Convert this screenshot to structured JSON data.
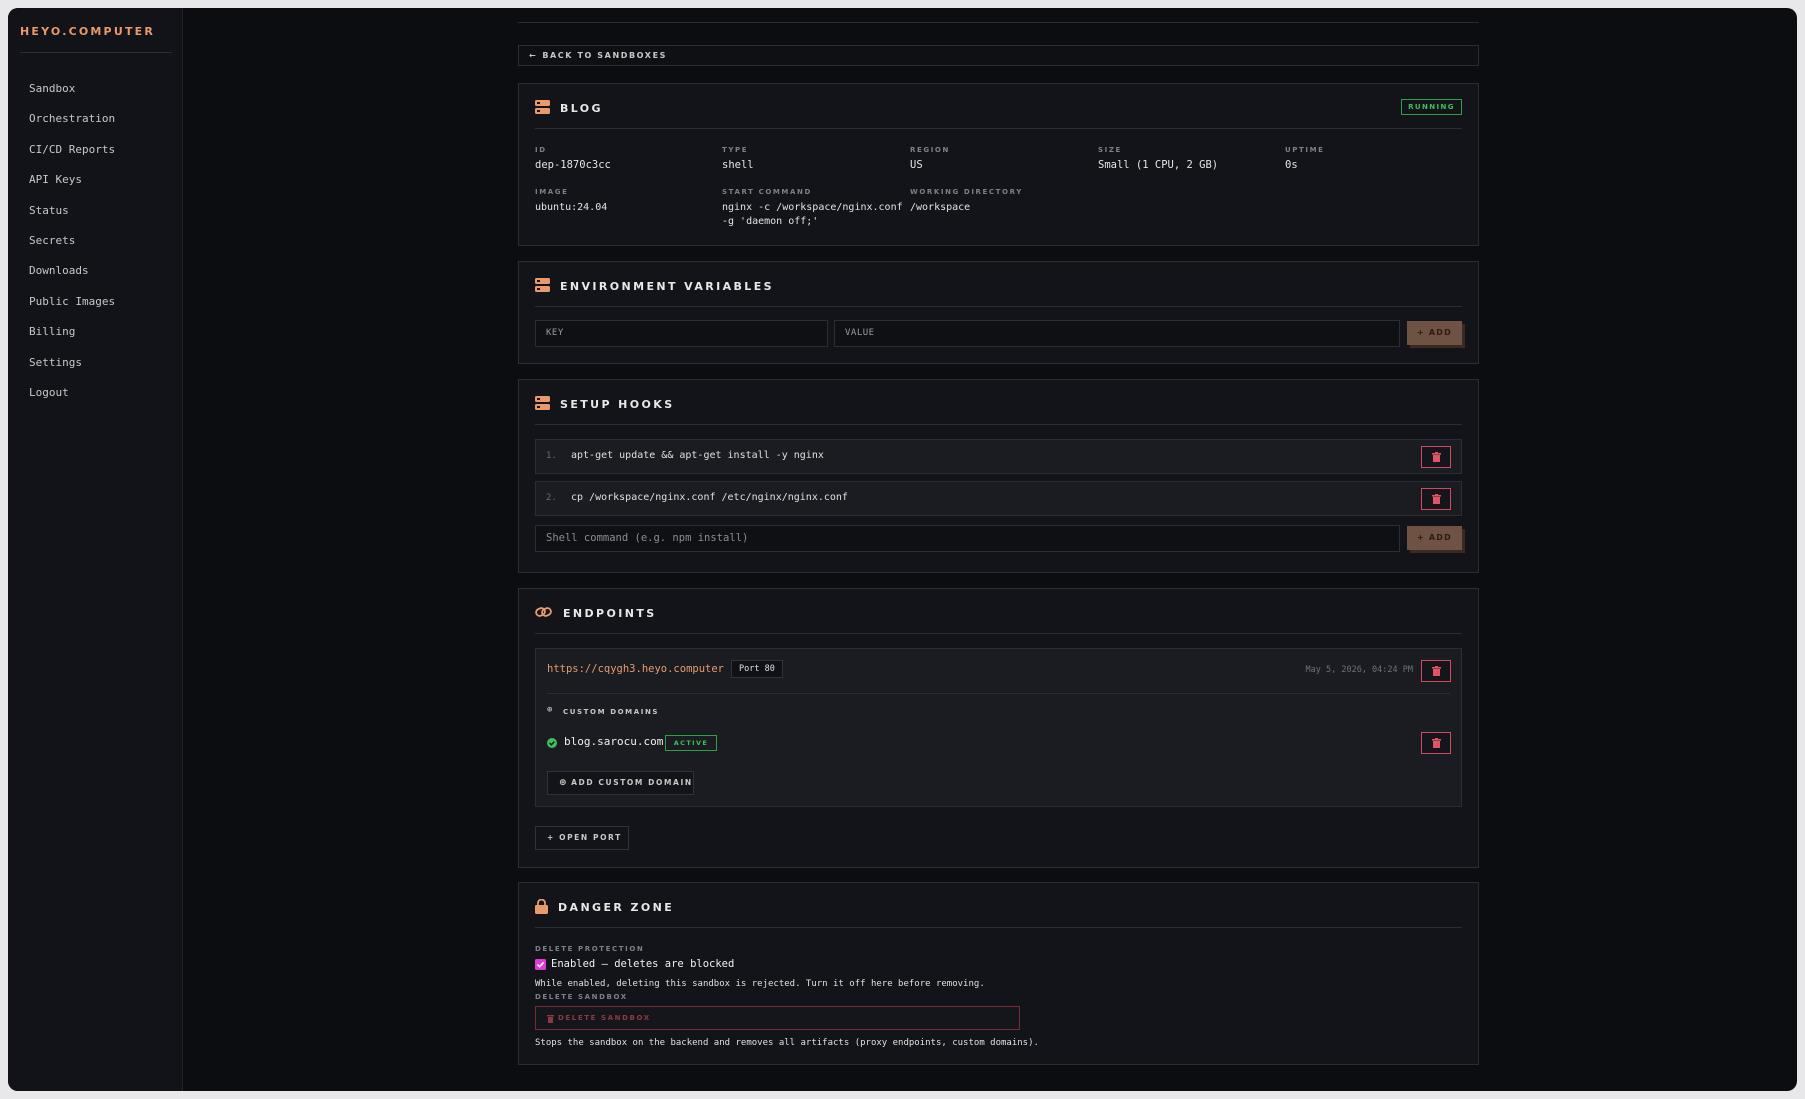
{
  "brand": "HEYO.COMPUTER",
  "nav": [
    "Sandbox",
    "Orchestration",
    "CI/CD Reports",
    "API Keys",
    "Status",
    "Secrets",
    "Downloads",
    "Public Images",
    "Billing",
    "Settings",
    "Logout"
  ],
  "back_label": "BACK TO SANDBOXES",
  "sandbox": {
    "title": "BLOG",
    "status": "RUNNING",
    "fields": {
      "id_label": "ID",
      "id": "dep-1870c3cc",
      "type_label": "TYPE",
      "type": "shell",
      "region_label": "REGION",
      "region": "US",
      "size_label": "SIZE",
      "size": "Small (1 CPU, 2 GB)",
      "uptime_label": "UPTIME",
      "uptime": "0s",
      "image_label": "IMAGE",
      "image": "ubuntu:24.04",
      "start_label": "START COMMAND",
      "start_line1": "nginx -c /workspace/nginx.conf",
      "start_line2": "-g 'daemon off;'",
      "workdir_label": "WORKING DIRECTORY",
      "workdir": "/workspace"
    }
  },
  "env": {
    "title": "ENVIRONMENT VARIABLES",
    "key_placeholder": "KEY",
    "value_placeholder": "VALUE",
    "add_label": "+ ADD"
  },
  "hooks": {
    "title": "SETUP HOOKS",
    "items": [
      {
        "num": "1.",
        "cmd": "apt-get update && apt-get install -y nginx"
      },
      {
        "num": "2.",
        "cmd": "cp /workspace/nginx.conf /etc/nginx/nginx.conf"
      }
    ],
    "placeholder": "Shell command (e.g. npm install)",
    "add_label": "+ ADD"
  },
  "endpoints": {
    "title": "ENDPOINTS",
    "url": "https://cqygh3.heyo.computer",
    "port": "Port 80",
    "date": "May 5, 2026, 04:24 PM",
    "custom_domains_label": "CUSTOM DOMAINS",
    "domain": "blog.sarocu.com",
    "domain_status": "ACTIVE",
    "add_domain_label": "ADD CUSTOM DOMAIN",
    "open_port_label": "+ OPEN PORT"
  },
  "danger": {
    "title": "DANGER ZONE",
    "protection_label": "DELETE PROTECTION",
    "protection_text": "Enabled — deletes are blocked",
    "protection_note": "While enabled, deleting this sandbox is rejected. Turn it off here before removing.",
    "delete_label": "DELETE SANDBOX",
    "delete_button": "DELETE SANDBOX",
    "delete_note": "Stops the sandbox on the backend and removes all artifacts (proxy endpoints, custom domains)."
  },
  "colors": {
    "accent": "#e89a6a",
    "success": "#3fbf58",
    "danger": "#d24a5a",
    "checkbox": "#e23ad9"
  }
}
